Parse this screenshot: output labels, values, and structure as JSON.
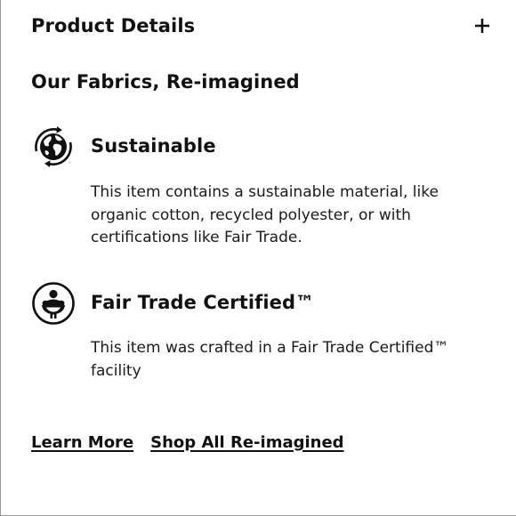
{
  "header": {
    "title": "Product Details",
    "expand_icon": "plus-icon"
  },
  "section": {
    "title": "Our Fabrics, Re-imagined"
  },
  "features": [
    {
      "icon": "globe-recycle-icon",
      "name": "Sustainable",
      "description": "This item contains a sustainable material, like organic cotton, recycled polyester, or with certifications like Fair Trade."
    },
    {
      "icon": "fair-trade-person-icon",
      "name": "Fair Trade Certified™",
      "description": "This item was crafted in a Fair Trade Certified™ facility"
    }
  ],
  "links": {
    "learn_more": "Learn More",
    "shop_all": "Shop All Re-imagined"
  },
  "colors": {
    "text": "#111111",
    "background": "#ffffff",
    "border": "#9a9a9a"
  }
}
